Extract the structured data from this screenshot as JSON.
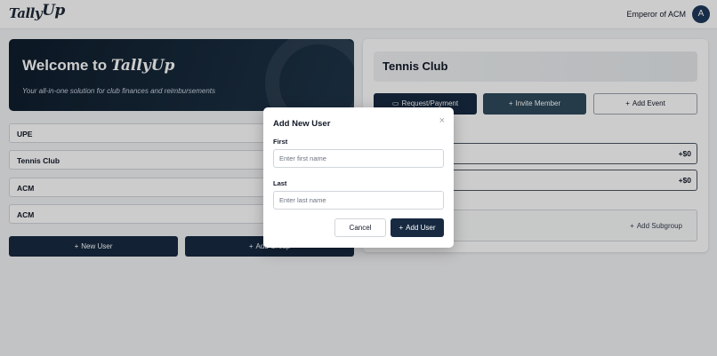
{
  "app": {
    "logo_prefix": "Tally",
    "logo_suffix": "Up"
  },
  "header": {
    "org_name": "Emperor of ACM",
    "avatar_initial": "A"
  },
  "hero": {
    "title": "Welcome to",
    "brand_prefix": "Tally",
    "brand_suffix": "Up",
    "subtitle": "Your all-in-one solution for club finances and reimbursements"
  },
  "clubs": [
    {
      "name": "UPE"
    },
    {
      "name": "Tennis Club"
    },
    {
      "name": "ACM"
    },
    {
      "name": "ACM"
    }
  ],
  "left_actions": {
    "new_user": "New User",
    "add_group": "Add Group"
  },
  "group": {
    "title": "Tennis Club",
    "actions": {
      "request_payment": "Request/Payment",
      "invite_member": "Invite Member",
      "add_event": "Add Event"
    },
    "members": [
      {
        "amount": "+$0"
      },
      {
        "amount": "+$0"
      }
    ],
    "add_subgroup": "Add Subgroup"
  },
  "modal": {
    "title": "Add New User",
    "close_glyph": "×",
    "first_label": "First",
    "first_placeholder": "Enter first name",
    "first_value": "",
    "last_label": "Last",
    "last_placeholder": "Enter last name",
    "last_value": "",
    "cancel_label": "Cancel",
    "add_label": "Add User"
  },
  "icons": {
    "plus": "plus-icon",
    "card": "card-icon",
    "close": "close-icon"
  },
  "colors": {
    "primary": "#172a42",
    "hero_start": "#0f1d2c",
    "hero_end": "#1e3448"
  }
}
